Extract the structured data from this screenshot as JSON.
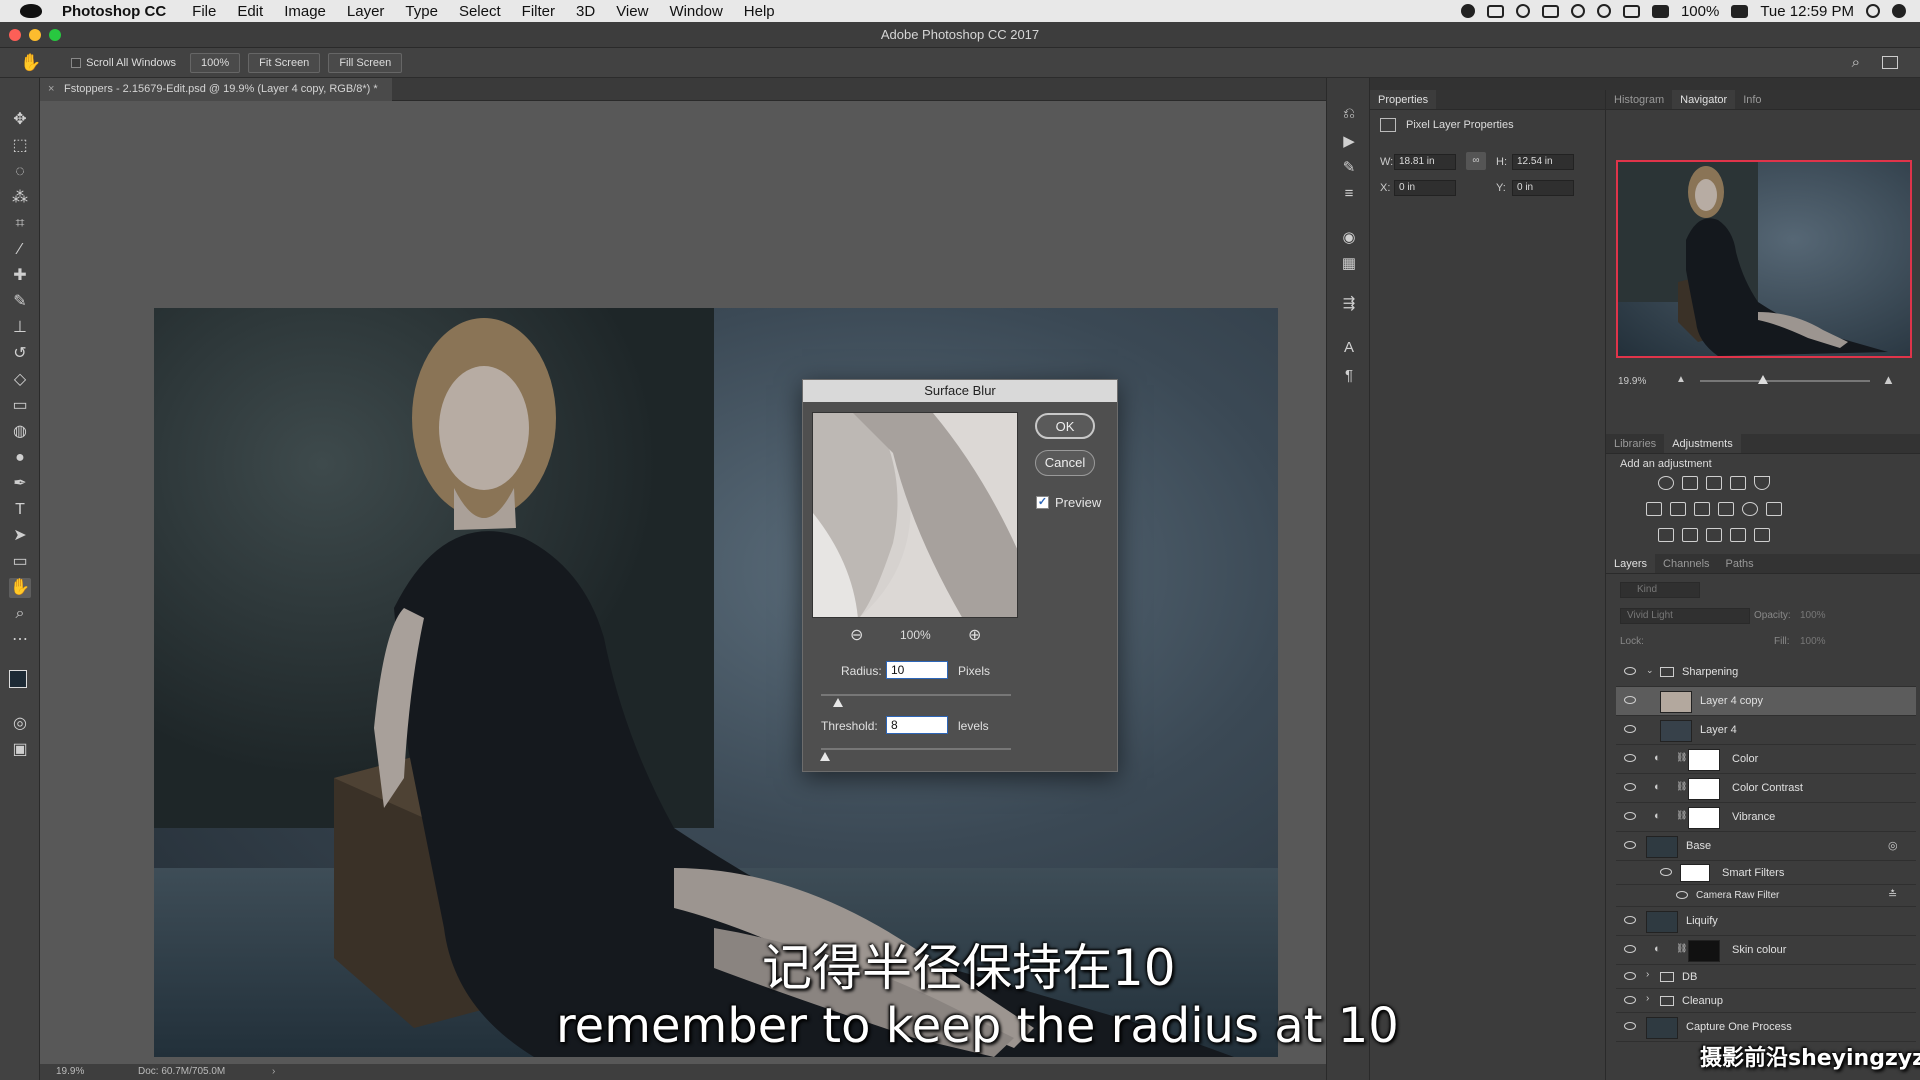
{
  "menubar": {
    "app": "Photoshop CC",
    "items": [
      "File",
      "Edit",
      "Image",
      "Layer",
      "Type",
      "Select",
      "Filter",
      "3D",
      "View",
      "Window",
      "Help"
    ],
    "battery": "100%",
    "clock": "Tue 12:59 PM"
  },
  "window": {
    "title": "Adobe Photoshop CC 2017"
  },
  "options": {
    "scroll_all": "Scroll All Windows",
    "zoom_btn": "100%",
    "fit_btn": "Fit Screen",
    "fill_btn": "Fill Screen"
  },
  "document": {
    "tab": "Fstoppers - 2.15679-Edit.psd @ 19.9% (Layer 4 copy, RGB/8*) *",
    "zoom": "19.9%",
    "doc_size": "Doc: 60.7M/705.0M"
  },
  "dialog": {
    "title": "Surface Blur",
    "ok": "OK",
    "cancel": "Cancel",
    "preview": "Preview",
    "preview_checked": true,
    "zoom": "100%",
    "radius_label": "Radius:",
    "radius_value": "10",
    "radius_unit": "Pixels",
    "threshold_label": "Threshold:",
    "threshold_value": "8",
    "threshold_unit": "levels"
  },
  "properties": {
    "tab": "Properties",
    "heading": "Pixel Layer Properties",
    "w_label": "W:",
    "w_value": "18.81 in",
    "h_label": "H:",
    "h_value": "12.54 in",
    "x_label": "X:",
    "x_value": "0 in",
    "y_label": "Y:",
    "y_value": "0 in"
  },
  "navigator": {
    "tabs": [
      "Histogram",
      "Navigator",
      "Info"
    ],
    "zoom": "19.9%"
  },
  "adjustments": {
    "tabs": [
      "Libraries",
      "Adjustments"
    ],
    "heading": "Add an adjustment"
  },
  "layers": {
    "tabs": [
      "Layers",
      "Channels",
      "Paths"
    ],
    "kind": "Kind",
    "blend": "Vivid Light",
    "opacity_label": "Opacity:",
    "opacity": "100%",
    "lock_label": "Lock:",
    "fill_label": "Fill:",
    "fill": "100%",
    "items": [
      {
        "name": "Sharpening"
      },
      {
        "name": "Layer 4 copy"
      },
      {
        "name": "Layer 4"
      },
      {
        "name": "Color"
      },
      {
        "name": "Color Contrast"
      },
      {
        "name": "Vibrance"
      },
      {
        "name": "Base"
      },
      {
        "name": "Smart Filters"
      },
      {
        "name": "Camera Raw Filter"
      },
      {
        "name": "Liquify"
      },
      {
        "name": "Skin colour"
      },
      {
        "name": "DB"
      },
      {
        "name": "Cleanup"
      },
      {
        "name": "Capture One Process"
      }
    ]
  },
  "subtitles": {
    "chinese": "记得半径保持在10",
    "english": "remember to keep the radius at 10",
    "watermark": "摄影前沿sheyingzyz.com"
  },
  "colors": {
    "panel": "#3c3c3c",
    "selection": "#5c5c5c",
    "accent": "#2d66b8"
  }
}
